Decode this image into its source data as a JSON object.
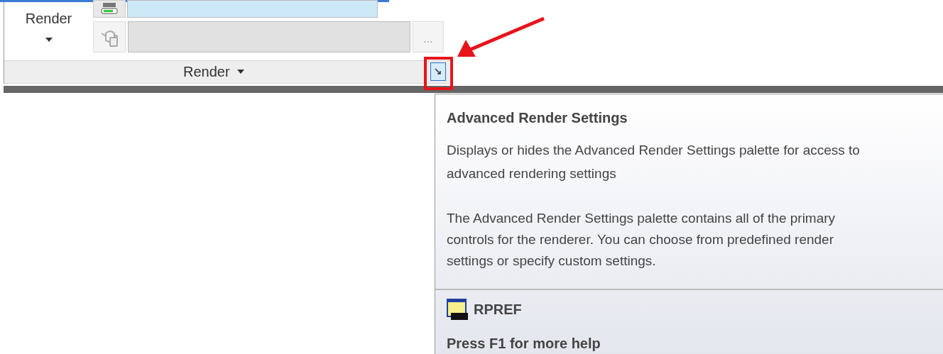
{
  "ribbon": {
    "button_label": "Render",
    "more_button": "...",
    "panel_title": "Render"
  },
  "tooltip": {
    "title": "Advanced Render Settings",
    "description": "Displays or hides the Advanced Render Settings palette for access to advanced rendering settings",
    "details": "The Advanced Render Settings palette contains all of the primary controls for the renderer. You can choose from predefined render settings or specify custom settings.",
    "command": "RPREF",
    "help": "Press F1 for more help"
  }
}
